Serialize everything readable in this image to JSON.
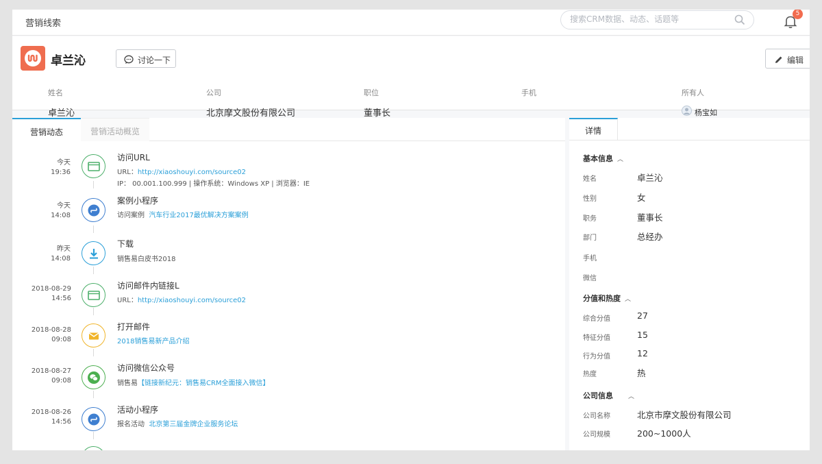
{
  "topbar": {
    "title": "营销线索",
    "search_placeholder": "搜索CRM数据、动态、话题等",
    "notification_count": "5"
  },
  "lead": {
    "name": "卓兰沁",
    "discuss_label": "讨论一下",
    "edit_label": "编辑",
    "fields": [
      {
        "label": "姓名",
        "value": "卓兰沁"
      },
      {
        "label": "公司",
        "value": "北京摩文股份有限公司"
      },
      {
        "label": "职位",
        "value": "董事长"
      },
      {
        "label": "手机",
        "value": ""
      },
      {
        "label": "所有人",
        "value": "杨宝如"
      }
    ]
  },
  "left_tabs": [
    {
      "label": "营销动态",
      "active": true
    },
    {
      "label": "营销活动概览",
      "active": false
    }
  ],
  "timeline": [
    {
      "day": "今天",
      "time": "19:36",
      "icon": "browser-icon",
      "color": "#4caf6a",
      "title": "访问URL",
      "sub_prefix": "URL：",
      "sub_link": "http://xiaoshouyi.com/source02",
      "sub2": "IP： 00.001.100.999 | 操作系统：Windows XP | 浏览器：IE"
    },
    {
      "day": "今天",
      "time": "14:08",
      "icon": "mini-program-icon",
      "color": "#3f7fd0",
      "title": "案例小程序",
      "sub_prefix": "访问案例",
      "sub_link": "汽车行业2017最优解决方案案例",
      "sub2": ""
    },
    {
      "day": "昨天",
      "time": "14:08",
      "icon": "download-icon",
      "color": "#2a9fd8",
      "title": "下载",
      "sub_prefix": "销售易白皮书2018",
      "sub_link": "",
      "sub2": ""
    },
    {
      "day": "2018-08-29",
      "time": "14:56",
      "icon": "browser-icon",
      "color": "#4caf6a",
      "title": "访问邮件内链接L",
      "sub_prefix": "URL：",
      "sub_link": "http://xiaoshouyi.com/source02",
      "sub2": ""
    },
    {
      "day": "2018-08-28",
      "time": "09:08",
      "icon": "mail-icon",
      "color": "#f0b429",
      "title": "打开邮件",
      "sub_prefix": "",
      "sub_link": "2018销售易新产品介绍",
      "sub2": ""
    },
    {
      "day": "2018-08-27",
      "time": "09:08",
      "icon": "wechat-icon",
      "color": "#4caf50",
      "title": "访问微信公众号",
      "sub_prefix": "销售易",
      "sub_link": "【链接新纪元：销售易CRM全面接入微信】",
      "sub2": ""
    },
    {
      "day": "2018-08-26",
      "time": "14:56",
      "icon": "mini-program-icon",
      "color": "#3f7fd0",
      "title": "活动小程序",
      "sub_prefix": "报名活动",
      "sub_link": "北京第三届金牌企业服务论坛",
      "sub2": ""
    }
  ],
  "details": {
    "tab_label": "详情",
    "basic_title": "基本信息",
    "basic": [
      {
        "k": "姓名",
        "v": "卓兰沁"
      },
      {
        "k": "性别",
        "v": "女"
      },
      {
        "k": "职务",
        "v": "董事长"
      },
      {
        "k": "部门",
        "v": "总经办"
      },
      {
        "k": "手机",
        "v": ""
      },
      {
        "k": "微信",
        "v": ""
      }
    ],
    "score_title": "分值和热度",
    "score": [
      {
        "k": "综合分值",
        "v": "27"
      },
      {
        "k": "特征分值",
        "v": "15"
      },
      {
        "k": "行为分值",
        "v": "12"
      },
      {
        "k": "热度",
        "v": "热"
      }
    ],
    "company_title": "公司信息",
    "company": [
      {
        "k": "公司名称",
        "v": "北京市摩文股份有限公司"
      },
      {
        "k": "公司规模",
        "v": "200~1000人"
      }
    ]
  }
}
